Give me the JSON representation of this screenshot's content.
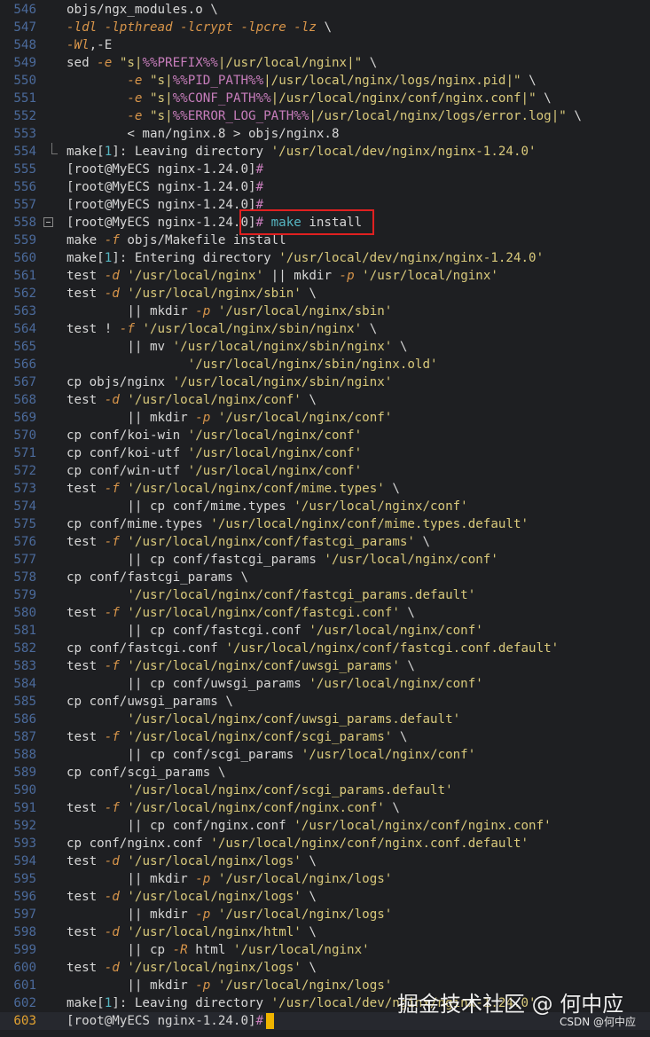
{
  "editor": {
    "lines": [
      {
        "n": "546",
        "segs": [
          [
            "  objs/ngx_modules.o \\",
            ""
          ]
        ]
      },
      {
        "n": "547",
        "segs": [
          [
            "  ",
            ""
          ],
          [
            "-ldl",
            "f"
          ],
          [
            " ",
            ""
          ],
          [
            "-lpthread",
            "f"
          ],
          [
            " ",
            ""
          ],
          [
            "-lcrypt",
            "f"
          ],
          [
            " ",
            ""
          ],
          [
            "-lpcre",
            "f"
          ],
          [
            " ",
            ""
          ],
          [
            "-lz",
            "f"
          ],
          [
            " \\",
            ""
          ]
        ]
      },
      {
        "n": "548",
        "segs": [
          [
            "  ",
            ""
          ],
          [
            "-Wl",
            "f"
          ],
          [
            ",-E",
            ""
          ]
        ]
      },
      {
        "n": "549",
        "segs": [
          [
            "  sed ",
            ""
          ],
          [
            "-e",
            "f"
          ],
          [
            " ",
            ""
          ],
          [
            "\"s|",
            "s"
          ],
          [
            "%%PREFIX%%",
            "v"
          ],
          [
            "|/usr/local/nginx|\"",
            "s"
          ],
          [
            " \\",
            ""
          ]
        ]
      },
      {
        "n": "550",
        "segs": [
          [
            "          ",
            ""
          ],
          [
            "-e",
            "f"
          ],
          [
            " ",
            ""
          ],
          [
            "\"s|",
            "s"
          ],
          [
            "%%PID_PATH%%",
            "v"
          ],
          [
            "|/usr/local/nginx/logs/nginx.pid|\"",
            "s"
          ],
          [
            " \\",
            ""
          ]
        ]
      },
      {
        "n": "551",
        "segs": [
          [
            "          ",
            ""
          ],
          [
            "-e",
            "f"
          ],
          [
            " ",
            ""
          ],
          [
            "\"s|",
            "s"
          ],
          [
            "%%CONF_PATH%%",
            "v"
          ],
          [
            "|/usr/local/nginx/conf/nginx.conf|\"",
            "s"
          ],
          [
            " \\",
            ""
          ]
        ]
      },
      {
        "n": "552",
        "segs": [
          [
            "          ",
            ""
          ],
          [
            "-e",
            "f"
          ],
          [
            " ",
            ""
          ],
          [
            "\"s|",
            "s"
          ],
          [
            "%%ERROR_LOG_PATH%%",
            "v"
          ],
          [
            "|/usr/local/nginx/logs/error.log|\"",
            "s"
          ],
          [
            " \\",
            ""
          ]
        ]
      },
      {
        "n": "553",
        "segs": [
          [
            "          < man/nginx.8 > objs/nginx.8",
            ""
          ]
        ]
      },
      {
        "n": "554",
        "segs": [
          [
            "  make[",
            ""
          ],
          [
            "1",
            "c"
          ],
          [
            "]: Leaving directory ",
            ""
          ],
          [
            "'/usr/local/dev/nginx/nginx-1.24.0'",
            "s"
          ]
        ]
      },
      {
        "n": "555",
        "segs": [
          [
            "  [root@MyECS nginx-1.24.0]",
            ""
          ],
          [
            "#",
            "v"
          ]
        ]
      },
      {
        "n": "556",
        "segs": [
          [
            "  [root@MyECS nginx-1.24.0]",
            ""
          ],
          [
            "#",
            "v"
          ]
        ]
      },
      {
        "n": "557",
        "segs": [
          [
            "  [root@MyECS nginx-1.24.0]",
            ""
          ],
          [
            "#",
            "v"
          ]
        ]
      },
      {
        "n": "558",
        "segs": [
          [
            "  [root@MyECS nginx-1.24.0]",
            ""
          ],
          [
            "#",
            "v"
          ],
          [
            " ",
            ""
          ],
          [
            "make",
            "c"
          ],
          [
            " install",
            ""
          ]
        ]
      },
      {
        "n": "559",
        "segs": [
          [
            "  make ",
            ""
          ],
          [
            "-f",
            "f"
          ],
          [
            " objs/Makefile install",
            ""
          ]
        ]
      },
      {
        "n": "560",
        "segs": [
          [
            "  make[",
            ""
          ],
          [
            "1",
            "c"
          ],
          [
            "]: Entering directory ",
            ""
          ],
          [
            "'/usr/local/dev/nginx/nginx-1.24.0'",
            "s"
          ]
        ]
      },
      {
        "n": "561",
        "segs": [
          [
            "  test ",
            ""
          ],
          [
            "-d",
            "f"
          ],
          [
            " ",
            ""
          ],
          [
            "'/usr/local/nginx'",
            "s"
          ],
          [
            " || mkdir ",
            ""
          ],
          [
            "-p",
            "f"
          ],
          [
            " ",
            ""
          ],
          [
            "'/usr/local/nginx'",
            "s"
          ]
        ]
      },
      {
        "n": "562",
        "segs": [
          [
            "  test ",
            ""
          ],
          [
            "-d",
            "f"
          ],
          [
            " ",
            ""
          ],
          [
            "'/usr/local/nginx/sbin'",
            "s"
          ],
          [
            " \\",
            ""
          ]
        ]
      },
      {
        "n": "563",
        "segs": [
          [
            "          || mkdir ",
            ""
          ],
          [
            "-p",
            "f"
          ],
          [
            " ",
            ""
          ],
          [
            "'/usr/local/nginx/sbin'",
            "s"
          ]
        ]
      },
      {
        "n": "564",
        "segs": [
          [
            "  test ! ",
            ""
          ],
          [
            "-f",
            "f"
          ],
          [
            " ",
            ""
          ],
          [
            "'/usr/local/nginx/sbin/nginx'",
            "s"
          ],
          [
            " \\",
            ""
          ]
        ]
      },
      {
        "n": "565",
        "segs": [
          [
            "          || mv ",
            ""
          ],
          [
            "'/usr/local/nginx/sbin/nginx'",
            "s"
          ],
          [
            " \\",
            ""
          ]
        ]
      },
      {
        "n": "566",
        "segs": [
          [
            "                  ",
            ""
          ],
          [
            "'/usr/local/nginx/sbin/nginx.old'",
            "s"
          ]
        ]
      },
      {
        "n": "567",
        "segs": [
          [
            "  cp objs/nginx ",
            ""
          ],
          [
            "'/usr/local/nginx/sbin/nginx'",
            "s"
          ]
        ]
      },
      {
        "n": "568",
        "segs": [
          [
            "  test ",
            ""
          ],
          [
            "-d",
            "f"
          ],
          [
            " ",
            ""
          ],
          [
            "'/usr/local/nginx/conf'",
            "s"
          ],
          [
            " \\",
            ""
          ]
        ]
      },
      {
        "n": "569",
        "segs": [
          [
            "          || mkdir ",
            ""
          ],
          [
            "-p",
            "f"
          ],
          [
            " ",
            ""
          ],
          [
            "'/usr/local/nginx/conf'",
            "s"
          ]
        ]
      },
      {
        "n": "570",
        "segs": [
          [
            "  cp conf/koi-win ",
            ""
          ],
          [
            "'/usr/local/nginx/conf'",
            "s"
          ]
        ]
      },
      {
        "n": "571",
        "segs": [
          [
            "  cp conf/koi-utf ",
            ""
          ],
          [
            "'/usr/local/nginx/conf'",
            "s"
          ]
        ]
      },
      {
        "n": "572",
        "segs": [
          [
            "  cp conf/win-utf ",
            ""
          ],
          [
            "'/usr/local/nginx/conf'",
            "s"
          ]
        ]
      },
      {
        "n": "573",
        "segs": [
          [
            "  test ",
            ""
          ],
          [
            "-f",
            "f"
          ],
          [
            " ",
            ""
          ],
          [
            "'/usr/local/nginx/conf/mime.types'",
            "s"
          ],
          [
            " \\",
            ""
          ]
        ]
      },
      {
        "n": "574",
        "segs": [
          [
            "          || cp conf/mime.types ",
            ""
          ],
          [
            "'/usr/local/nginx/conf'",
            "s"
          ]
        ]
      },
      {
        "n": "575",
        "segs": [
          [
            "  cp conf/mime.types ",
            ""
          ],
          [
            "'/usr/local/nginx/conf/mime.types.default'",
            "s"
          ]
        ]
      },
      {
        "n": "576",
        "segs": [
          [
            "  test ",
            ""
          ],
          [
            "-f",
            "f"
          ],
          [
            " ",
            ""
          ],
          [
            "'/usr/local/nginx/conf/fastcgi_params'",
            "s"
          ],
          [
            " \\",
            ""
          ]
        ]
      },
      {
        "n": "577",
        "segs": [
          [
            "          || cp conf/fastcgi_params ",
            ""
          ],
          [
            "'/usr/local/nginx/conf'",
            "s"
          ]
        ]
      },
      {
        "n": "578",
        "segs": [
          [
            "  cp conf/fastcgi_params \\",
            ""
          ]
        ]
      },
      {
        "n": "579",
        "segs": [
          [
            "          ",
            ""
          ],
          [
            "'/usr/local/nginx/conf/fastcgi_params.default'",
            "s"
          ]
        ]
      },
      {
        "n": "580",
        "segs": [
          [
            "  test ",
            ""
          ],
          [
            "-f",
            "f"
          ],
          [
            " ",
            ""
          ],
          [
            "'/usr/local/nginx/conf/fastcgi.conf'",
            "s"
          ],
          [
            " \\",
            ""
          ]
        ]
      },
      {
        "n": "581",
        "segs": [
          [
            "          || cp conf/fastcgi.conf ",
            ""
          ],
          [
            "'/usr/local/nginx/conf'",
            "s"
          ]
        ]
      },
      {
        "n": "582",
        "segs": [
          [
            "  cp conf/fastcgi.conf ",
            ""
          ],
          [
            "'/usr/local/nginx/conf/fastcgi.conf.default'",
            "s"
          ]
        ]
      },
      {
        "n": "583",
        "segs": [
          [
            "  test ",
            ""
          ],
          [
            "-f",
            "f"
          ],
          [
            " ",
            ""
          ],
          [
            "'/usr/local/nginx/conf/uwsgi_params'",
            "s"
          ],
          [
            " \\",
            ""
          ]
        ]
      },
      {
        "n": "584",
        "segs": [
          [
            "          || cp conf/uwsgi_params ",
            ""
          ],
          [
            "'/usr/local/nginx/conf'",
            "s"
          ]
        ]
      },
      {
        "n": "585",
        "segs": [
          [
            "  cp conf/uwsgi_params \\",
            ""
          ]
        ]
      },
      {
        "n": "586",
        "segs": [
          [
            "          ",
            ""
          ],
          [
            "'/usr/local/nginx/conf/uwsgi_params.default'",
            "s"
          ]
        ]
      },
      {
        "n": "587",
        "segs": [
          [
            "  test ",
            ""
          ],
          [
            "-f",
            "f"
          ],
          [
            " ",
            ""
          ],
          [
            "'/usr/local/nginx/conf/scgi_params'",
            "s"
          ],
          [
            " \\",
            ""
          ]
        ]
      },
      {
        "n": "588",
        "segs": [
          [
            "          || cp conf/scgi_params ",
            ""
          ],
          [
            "'/usr/local/nginx/conf'",
            "s"
          ]
        ]
      },
      {
        "n": "589",
        "segs": [
          [
            "  cp conf/scgi_params \\",
            ""
          ]
        ]
      },
      {
        "n": "590",
        "segs": [
          [
            "          ",
            ""
          ],
          [
            "'/usr/local/nginx/conf/scgi_params.default'",
            "s"
          ]
        ]
      },
      {
        "n": "591",
        "segs": [
          [
            "  test ",
            ""
          ],
          [
            "-f",
            "f"
          ],
          [
            " ",
            ""
          ],
          [
            "'/usr/local/nginx/conf/nginx.conf'",
            "s"
          ],
          [
            " \\",
            ""
          ]
        ]
      },
      {
        "n": "592",
        "segs": [
          [
            "          || cp conf/nginx.conf ",
            ""
          ],
          [
            "'/usr/local/nginx/conf/nginx.conf'",
            "s"
          ]
        ]
      },
      {
        "n": "593",
        "segs": [
          [
            "  cp conf/nginx.conf ",
            ""
          ],
          [
            "'/usr/local/nginx/conf/nginx.conf.default'",
            "s"
          ]
        ]
      },
      {
        "n": "594",
        "segs": [
          [
            "  test ",
            ""
          ],
          [
            "-d",
            "f"
          ],
          [
            " ",
            ""
          ],
          [
            "'/usr/local/nginx/logs'",
            "s"
          ],
          [
            " \\",
            ""
          ]
        ]
      },
      {
        "n": "595",
        "segs": [
          [
            "          || mkdir ",
            ""
          ],
          [
            "-p",
            "f"
          ],
          [
            " ",
            ""
          ],
          [
            "'/usr/local/nginx/logs'",
            "s"
          ]
        ]
      },
      {
        "n": "596",
        "segs": [
          [
            "  test ",
            ""
          ],
          [
            "-d",
            "f"
          ],
          [
            " ",
            ""
          ],
          [
            "'/usr/local/nginx/logs'",
            "s"
          ],
          [
            " \\",
            ""
          ]
        ]
      },
      {
        "n": "597",
        "segs": [
          [
            "          || mkdir ",
            ""
          ],
          [
            "-p",
            "f"
          ],
          [
            " ",
            ""
          ],
          [
            "'/usr/local/nginx/logs'",
            "s"
          ]
        ]
      },
      {
        "n": "598",
        "segs": [
          [
            "  test ",
            ""
          ],
          [
            "-d",
            "f"
          ],
          [
            " ",
            ""
          ],
          [
            "'/usr/local/nginx/html'",
            "s"
          ],
          [
            " \\",
            ""
          ]
        ]
      },
      {
        "n": "599",
        "segs": [
          [
            "          || cp ",
            ""
          ],
          [
            "-R",
            "f"
          ],
          [
            " html ",
            ""
          ],
          [
            "'/usr/local/nginx'",
            "s"
          ]
        ]
      },
      {
        "n": "600",
        "segs": [
          [
            "  test ",
            ""
          ],
          [
            "-d",
            "f"
          ],
          [
            " ",
            ""
          ],
          [
            "'/usr/local/nginx/logs'",
            "s"
          ],
          [
            " \\",
            ""
          ]
        ]
      },
      {
        "n": "601",
        "segs": [
          [
            "          || mkdir ",
            ""
          ],
          [
            "-p",
            "f"
          ],
          [
            " ",
            ""
          ],
          [
            "'/usr/local/nginx/logs'",
            "s"
          ]
        ]
      },
      {
        "n": "602",
        "segs": [
          [
            "  make[",
            ""
          ],
          [
            "1",
            "c"
          ],
          [
            "]: Leaving directory ",
            ""
          ],
          [
            "'/usr/local/dev/nginx/nginx-1.24.0'",
            "s"
          ]
        ]
      },
      {
        "n": "603",
        "segs": [
          [
            "  [root@MyECS nginx-1.24.0]",
            ""
          ],
          [
            "#",
            "v"
          ],
          [
            " ",
            ""
          ]
        ]
      }
    ],
    "active_line": "603",
    "highlighted_line": "558"
  },
  "colors": {
    "background": "#1e1f22",
    "flag": "#d8954a",
    "string": "#d9c97b",
    "variable": "#c77dbb",
    "command": "#56b6c2",
    "highlight_box": "#e02020",
    "cursor": "#f0b400"
  },
  "overlay": {
    "watermark": "掘金技术社区 @ 何中应",
    "badge": "CSDN @何中应"
  }
}
